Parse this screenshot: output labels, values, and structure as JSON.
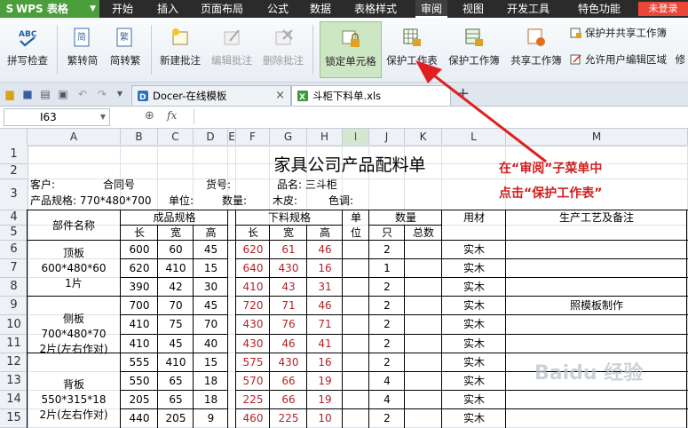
{
  "menubar": {
    "app_name": "WPS 表格",
    "items": [
      "开始",
      "插入",
      "页面布局",
      "公式",
      "数据",
      "表格样式",
      "审阅",
      "视图",
      "开发工具",
      "特色功能"
    ],
    "active": "审阅",
    "login": "未登录"
  },
  "ribbon": {
    "spell_check": "拼写检查",
    "to_traditional": "繁转简",
    "to_simplified": "简转繁",
    "new_comment": "新建批注",
    "edit_comment": "编辑批注",
    "delete_comment": "删除批注",
    "lock_cell": "锁定单元格",
    "protect_sheet": "保护工作表",
    "protect_workbook": "保护工作簿",
    "share_workbook": "共享工作簿",
    "protect_share": "保护并共享工作簿",
    "allow_edit_range": "允许用户编辑区域",
    "overflow_char": "修"
  },
  "tabs": {
    "tab1": "Docer-在线模板",
    "tab2": "斗柜下料单.xls",
    "add": "+"
  },
  "formula_bar": {
    "name_box": "I63",
    "fx": "fx",
    "value": ""
  },
  "grid": {
    "columns": [
      "A",
      "B",
      "C",
      "D",
      "E",
      "F",
      "G",
      "H",
      "I",
      "J",
      "K",
      "L",
      "M"
    ],
    "selected_column": "I",
    "rows": [
      "1",
      "2",
      "3",
      "4",
      "5",
      "6",
      "7",
      "8",
      "9",
      "10",
      "11",
      "12",
      "13",
      "14",
      "15"
    ]
  },
  "sheet": {
    "title": "家具公司产品配料单",
    "customer_label": "客户:",
    "contract_label": "合同号",
    "goods_no_label": "货号:",
    "product_name": "品名: 三斗柜",
    "spec_label": "产品规格: 770*480*700",
    "unit_label": "单位:",
    "qty_label": "数量:",
    "wood_skin_label": "木皮:",
    "color_label": "色调:",
    "headers": {
      "part_name": "部件名称",
      "finished_spec": "成品规格",
      "cut_spec": "下料规格",
      "unit": "单位",
      "quantity": "数量",
      "material": "用材",
      "process_notes": "生产工艺及备注",
      "length": "长",
      "width": "宽",
      "height": "高",
      "each": "只",
      "total": "总数"
    },
    "parts": [
      {
        "name": "顶板",
        "size": "600*480*60",
        "count": "1片"
      },
      {
        "name": "侧板",
        "size": "700*480*70",
        "count": "2片(左右作对)"
      },
      {
        "name": "背板",
        "size": "550*315*18",
        "count": "2片(左右作对)"
      }
    ],
    "data_rows": [
      {
        "b": "600",
        "c": "60",
        "d": "45",
        "f": "620",
        "g": "61",
        "h": "46",
        "j": "2",
        "l": "实木",
        "m": ""
      },
      {
        "b": "620",
        "c": "410",
        "d": "15",
        "f": "640",
        "g": "430",
        "h": "16",
        "j": "1",
        "l": "实木",
        "m": ""
      },
      {
        "b": "390",
        "c": "42",
        "d": "30",
        "f": "410",
        "g": "43",
        "h": "31",
        "j": "2",
        "l": "实木",
        "m": ""
      },
      {
        "b": "700",
        "c": "70",
        "d": "45",
        "f": "720",
        "g": "71",
        "h": "46",
        "j": "2",
        "l": "实木",
        "m": "照模板制作"
      },
      {
        "b": "410",
        "c": "75",
        "d": "70",
        "f": "430",
        "g": "76",
        "h": "71",
        "j": "2",
        "l": "实木",
        "m": ""
      },
      {
        "b": "410",
        "c": "45",
        "d": "40",
        "f": "430",
        "g": "46",
        "h": "41",
        "j": "2",
        "l": "实木",
        "m": ""
      },
      {
        "b": "555",
        "c": "410",
        "d": "15",
        "f": "575",
        "g": "430",
        "h": "16",
        "j": "2",
        "l": "实木",
        "m": ""
      },
      {
        "b": "550",
        "c": "65",
        "d": "18",
        "f": "570",
        "g": "66",
        "h": "19",
        "j": "4",
        "l": "实木",
        "m": ""
      },
      {
        "b": "205",
        "c": "65",
        "d": "18",
        "f": "225",
        "g": "66",
        "h": "19",
        "j": "4",
        "l": "实木",
        "m": ""
      },
      {
        "b": "440",
        "c": "205",
        "d": "9",
        "f": "460",
        "g": "225",
        "h": "10",
        "j": "2",
        "l": "实木",
        "m": ""
      }
    ]
  },
  "annotation": {
    "line1": "在“审阅”子菜单中",
    "line2": "点击“保护工作表”",
    "color": "#d02020"
  },
  "watermark": "Baidu 经验"
}
